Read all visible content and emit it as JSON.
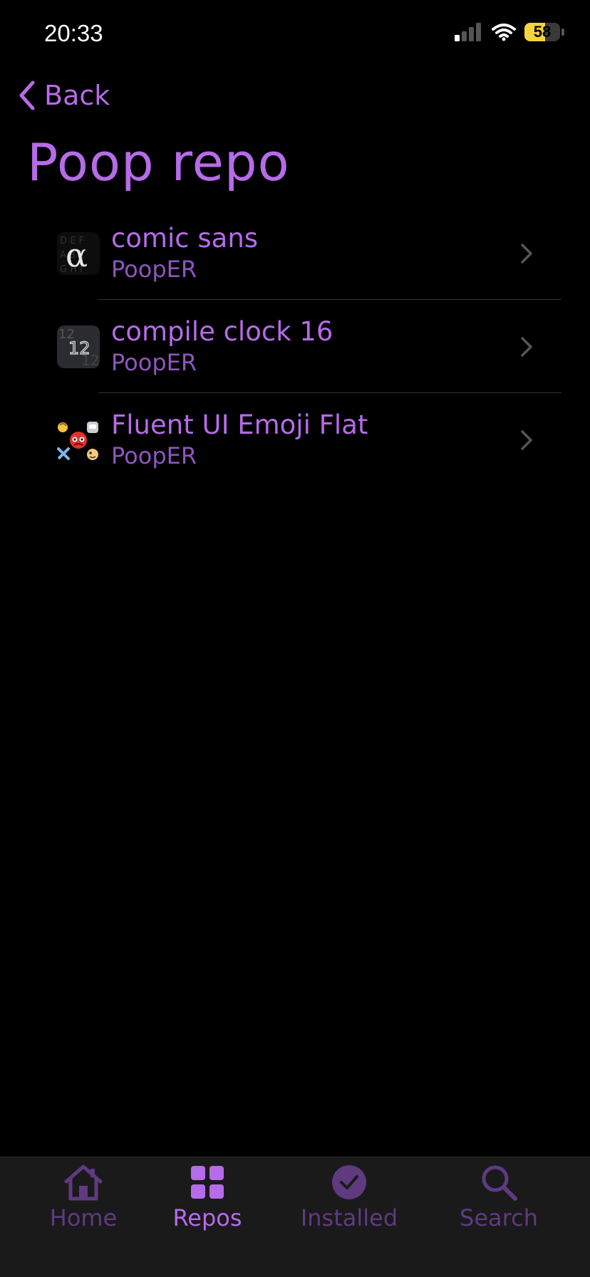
{
  "status_bar": {
    "time": "20:33",
    "battery": "58",
    "battery_level": 0.58
  },
  "nav": {
    "back_label": "Back"
  },
  "page": {
    "title": "Poop repo"
  },
  "packages": [
    {
      "title": "comic sans",
      "author": "PoopER",
      "icon": "font-alpha-icon"
    },
    {
      "title": "compile clock 16",
      "author": "PoopER",
      "icon": "clock-digits-icon"
    },
    {
      "title": "Fluent UI Emoji Flat",
      "author": "PoopER",
      "icon": "emoji-collage-icon"
    }
  ],
  "tabs": [
    {
      "label": "Home",
      "icon": "home-icon",
      "active": false
    },
    {
      "label": "Repos",
      "icon": "grid-icon",
      "active": true
    },
    {
      "label": "Installed",
      "icon": "check-circle-icon",
      "active": false
    },
    {
      "label": "Search",
      "icon": "search-icon",
      "active": false
    }
  ],
  "colors": {
    "accent": "#B66BE8",
    "accent_dim": "#5F3A80",
    "background": "#000000",
    "tabbar": "#1A1A1A",
    "battery": "#F4D33F"
  }
}
